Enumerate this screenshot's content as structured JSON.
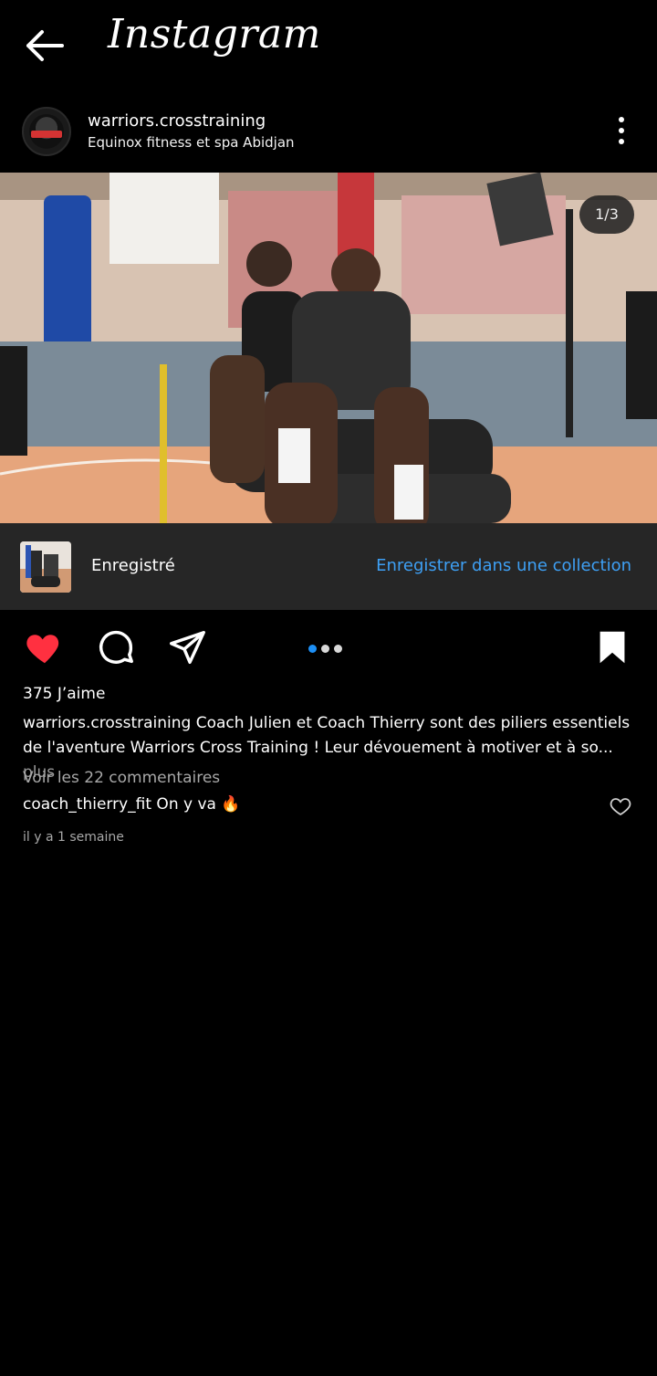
{
  "app": {
    "title": "Instagram"
  },
  "post": {
    "username": "warriors.crosstraining",
    "location": "Equinox fitness et spa Abidjan",
    "counter": "1/3",
    "saved_label": "Enregistré",
    "save_collection_link": "Enregistrer dans une collection",
    "likes": "375 J’aime",
    "caption_user": "warriors.crosstraining",
    "caption_text": " Coach Julien et Coach Thierry sont des piliers essentiels de l'aventure Warriors Cross Training ! Leur dévouement à motiver et à so...",
    "caption_more": " plus",
    "comments_link": "Voir les 22 commentaires",
    "comment_user": "coach_thierry_fit",
    "comment_text": " On y va 🔥",
    "timestamp": "il y a 1 semaine"
  },
  "colors": {
    "background": "#000000",
    "like_red": "#ff3040",
    "link_blue": "#3ea0f5",
    "saved_bar": "#262626"
  },
  "icons": [
    "back-arrow-icon",
    "more-options-icon",
    "heart-filled-icon",
    "comment-icon",
    "share-icon",
    "bookmark-filled-icon",
    "heart-outline-icon"
  ],
  "carousel": {
    "total": 3,
    "current": 1
  }
}
